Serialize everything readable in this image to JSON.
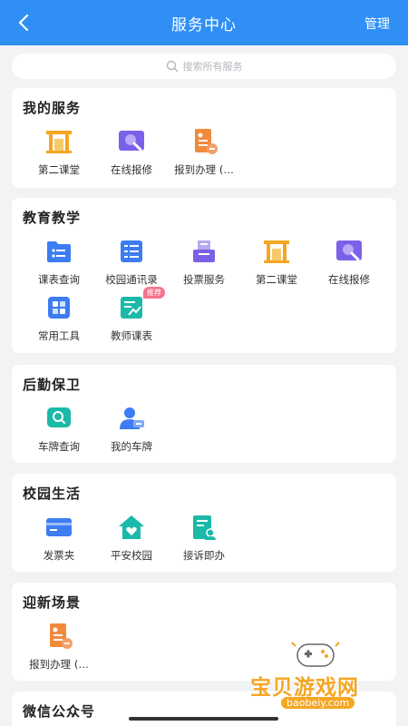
{
  "header": {
    "title": "服务中心",
    "manage_label": "管理"
  },
  "search": {
    "placeholder": "搜索所有服务"
  },
  "sections": [
    {
      "title": "我的服务",
      "items": [
        {
          "label": "第二课堂",
          "icon": "classroom-icon"
        },
        {
          "label": "在线报修",
          "icon": "repair-icon"
        },
        {
          "label": "报到办理 (…",
          "icon": "checkin-doc-icon"
        }
      ]
    },
    {
      "title": "教育教学",
      "items": [
        {
          "label": "课表查询",
          "icon": "schedule-icon"
        },
        {
          "label": "校园通讯录",
          "icon": "contacts-icon"
        },
        {
          "label": "投票服务",
          "icon": "vote-icon"
        },
        {
          "label": "第二课堂",
          "icon": "classroom-icon"
        },
        {
          "label": "在线报修",
          "icon": "repair-icon"
        },
        {
          "label": "常用工具",
          "icon": "tools-icon"
        },
        {
          "label": "教师课表",
          "icon": "teacher-schedule-icon",
          "badge": "推荐"
        }
      ]
    },
    {
      "title": "后勤保卫",
      "items": [
        {
          "label": "车牌查询",
          "icon": "plate-search-icon"
        },
        {
          "label": "我的车牌",
          "icon": "my-plate-icon"
        }
      ]
    },
    {
      "title": "校园生活",
      "items": [
        {
          "label": "发票夹",
          "icon": "invoice-icon"
        },
        {
          "label": "平安校园",
          "icon": "safe-campus-icon"
        },
        {
          "label": "接诉即办",
          "icon": "complaint-icon"
        }
      ]
    },
    {
      "title": "迎新场景",
      "items": [
        {
          "label": "报到办理 (…",
          "icon": "checkin-doc-icon"
        }
      ]
    },
    {
      "title": "微信公众号",
      "items": []
    }
  ],
  "watermark": {
    "text": "宝贝游戏网",
    "url": "baobeiy.com"
  },
  "colors": {
    "header": "#2f8ff5",
    "orange": "#f5a623",
    "purple": "#7b61e8",
    "blue": "#3d7cf2",
    "teal": "#1bb9a8"
  }
}
